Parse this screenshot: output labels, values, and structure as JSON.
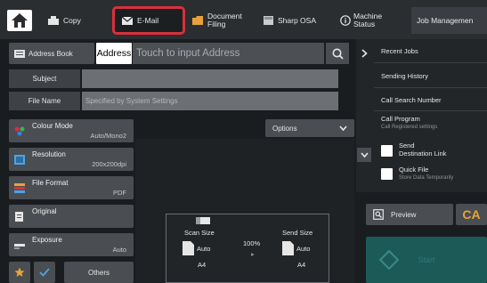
{
  "topbar": {
    "tabs": [
      {
        "label": "Copy",
        "icon": "copy-icon"
      },
      {
        "label": "E-Mail",
        "icon": "email-icon"
      },
      {
        "label": "Document Filing",
        "line1": "Document",
        "line2": "Filing",
        "icon": "folder-icon"
      },
      {
        "label": "Sharp OSA",
        "icon": "sharp-osa-icon"
      },
      {
        "label": "Machine Status",
        "line1": "Machine",
        "line2": "Status",
        "icon": "info-icon"
      },
      {
        "label": "Job Management",
        "short": "Job Managemen"
      }
    ],
    "highlight_color": "#d8303c"
  },
  "address": {
    "book_label": "Address Book",
    "label": "Address",
    "placeholder": "Touch to input Address"
  },
  "fields": {
    "subject_label": "Subject",
    "subject_value": "",
    "filename_label": "File Name",
    "filename_placeholder": "Specified by System Settings"
  },
  "settings": [
    {
      "title": "Colour Mode",
      "value": "Auto/Mono2",
      "icon": "colour-mode-icon"
    },
    {
      "title": "Resolution",
      "value": "200x200dpi",
      "icon": "resolution-icon"
    },
    {
      "title": "File Format",
      "value": "PDF",
      "icon": "file-format-icon"
    },
    {
      "title": "Original",
      "value": "",
      "icon": "original-icon"
    },
    {
      "title": "Exposure",
      "value": "Auto",
      "icon": "exposure-icon"
    }
  ],
  "options_label": "Options",
  "scan": {
    "scan_size_label": "Scan Size",
    "scan_auto": "Auto",
    "scan_paper": "A4",
    "ratio": "100%",
    "send_size_label": "Send Size",
    "send_auto": "Auto",
    "send_paper": "A4"
  },
  "bottom": {
    "others_label": "Others"
  },
  "right": {
    "recent_jobs": "Recent Jobs",
    "sending_history": "Sending History",
    "call_search_number": "Call Search Number",
    "call_program": "Call Program",
    "call_program_sub": "Call Registered settings",
    "send_dest_link_1": "Send",
    "send_dest_link_2": "Destination Link",
    "quick_file": "Quick File",
    "quick_file_sub": "Store Data Temporarily",
    "preview": "Preview",
    "ca": "CA",
    "start": "Start"
  },
  "colors": {
    "accent_orange": "#e8a23a",
    "start_teal": "#1c5a58",
    "check_blue": "#4fa3e0"
  }
}
